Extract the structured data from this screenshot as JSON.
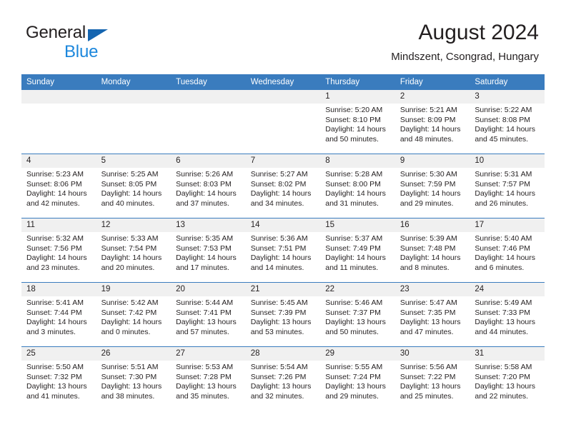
{
  "brand": {
    "word_one": "General",
    "word_two": "Blue",
    "triangle_color": "#1565b0",
    "blue_color": "#1c87dc"
  },
  "header": {
    "month_title": "August 2024",
    "location": "Mindszent, Csongrad, Hungary",
    "accent_color": "#3a7cbe",
    "daynum_bg": "#f0f0f0"
  },
  "calendar": {
    "weekday_headers": [
      "Sunday",
      "Monday",
      "Tuesday",
      "Wednesday",
      "Thursday",
      "Friday",
      "Saturday"
    ],
    "weeks": [
      [
        {
          "day": "",
          "sunrise": "",
          "sunset": "",
          "daylight_line1": "",
          "daylight_line2": "",
          "empty": true
        },
        {
          "day": "",
          "sunrise": "",
          "sunset": "",
          "daylight_line1": "",
          "daylight_line2": "",
          "empty": true
        },
        {
          "day": "",
          "sunrise": "",
          "sunset": "",
          "daylight_line1": "",
          "daylight_line2": "",
          "empty": true
        },
        {
          "day": "",
          "sunrise": "",
          "sunset": "",
          "daylight_line1": "",
          "daylight_line2": "",
          "empty": true
        },
        {
          "day": "1",
          "sunrise": "Sunrise: 5:20 AM",
          "sunset": "Sunset: 8:10 PM",
          "daylight_line1": "Daylight: 14 hours",
          "daylight_line2": "and 50 minutes.",
          "empty": false
        },
        {
          "day": "2",
          "sunrise": "Sunrise: 5:21 AM",
          "sunset": "Sunset: 8:09 PM",
          "daylight_line1": "Daylight: 14 hours",
          "daylight_line2": "and 48 minutes.",
          "empty": false
        },
        {
          "day": "3",
          "sunrise": "Sunrise: 5:22 AM",
          "sunset": "Sunset: 8:08 PM",
          "daylight_line1": "Daylight: 14 hours",
          "daylight_line2": "and 45 minutes.",
          "empty": false
        }
      ],
      [
        {
          "day": "4",
          "sunrise": "Sunrise: 5:23 AM",
          "sunset": "Sunset: 8:06 PM",
          "daylight_line1": "Daylight: 14 hours",
          "daylight_line2": "and 42 minutes.",
          "empty": false
        },
        {
          "day": "5",
          "sunrise": "Sunrise: 5:25 AM",
          "sunset": "Sunset: 8:05 PM",
          "daylight_line1": "Daylight: 14 hours",
          "daylight_line2": "and 40 minutes.",
          "empty": false
        },
        {
          "day": "6",
          "sunrise": "Sunrise: 5:26 AM",
          "sunset": "Sunset: 8:03 PM",
          "daylight_line1": "Daylight: 14 hours",
          "daylight_line2": "and 37 minutes.",
          "empty": false
        },
        {
          "day": "7",
          "sunrise": "Sunrise: 5:27 AM",
          "sunset": "Sunset: 8:02 PM",
          "daylight_line1": "Daylight: 14 hours",
          "daylight_line2": "and 34 minutes.",
          "empty": false
        },
        {
          "day": "8",
          "sunrise": "Sunrise: 5:28 AM",
          "sunset": "Sunset: 8:00 PM",
          "daylight_line1": "Daylight: 14 hours",
          "daylight_line2": "and 31 minutes.",
          "empty": false
        },
        {
          "day": "9",
          "sunrise": "Sunrise: 5:30 AM",
          "sunset": "Sunset: 7:59 PM",
          "daylight_line1": "Daylight: 14 hours",
          "daylight_line2": "and 29 minutes.",
          "empty": false
        },
        {
          "day": "10",
          "sunrise": "Sunrise: 5:31 AM",
          "sunset": "Sunset: 7:57 PM",
          "daylight_line1": "Daylight: 14 hours",
          "daylight_line2": "and 26 minutes.",
          "empty": false
        }
      ],
      [
        {
          "day": "11",
          "sunrise": "Sunrise: 5:32 AM",
          "sunset": "Sunset: 7:56 PM",
          "daylight_line1": "Daylight: 14 hours",
          "daylight_line2": "and 23 minutes.",
          "empty": false
        },
        {
          "day": "12",
          "sunrise": "Sunrise: 5:33 AM",
          "sunset": "Sunset: 7:54 PM",
          "daylight_line1": "Daylight: 14 hours",
          "daylight_line2": "and 20 minutes.",
          "empty": false
        },
        {
          "day": "13",
          "sunrise": "Sunrise: 5:35 AM",
          "sunset": "Sunset: 7:53 PM",
          "daylight_line1": "Daylight: 14 hours",
          "daylight_line2": "and 17 minutes.",
          "empty": false
        },
        {
          "day": "14",
          "sunrise": "Sunrise: 5:36 AM",
          "sunset": "Sunset: 7:51 PM",
          "daylight_line1": "Daylight: 14 hours",
          "daylight_line2": "and 14 minutes.",
          "empty": false
        },
        {
          "day": "15",
          "sunrise": "Sunrise: 5:37 AM",
          "sunset": "Sunset: 7:49 PM",
          "daylight_line1": "Daylight: 14 hours",
          "daylight_line2": "and 11 minutes.",
          "empty": false
        },
        {
          "day": "16",
          "sunrise": "Sunrise: 5:39 AM",
          "sunset": "Sunset: 7:48 PM",
          "daylight_line1": "Daylight: 14 hours",
          "daylight_line2": "and 8 minutes.",
          "empty": false
        },
        {
          "day": "17",
          "sunrise": "Sunrise: 5:40 AM",
          "sunset": "Sunset: 7:46 PM",
          "daylight_line1": "Daylight: 14 hours",
          "daylight_line2": "and 6 minutes.",
          "empty": false
        }
      ],
      [
        {
          "day": "18",
          "sunrise": "Sunrise: 5:41 AM",
          "sunset": "Sunset: 7:44 PM",
          "daylight_line1": "Daylight: 14 hours",
          "daylight_line2": "and 3 minutes.",
          "empty": false
        },
        {
          "day": "19",
          "sunrise": "Sunrise: 5:42 AM",
          "sunset": "Sunset: 7:42 PM",
          "daylight_line1": "Daylight: 14 hours",
          "daylight_line2": "and 0 minutes.",
          "empty": false
        },
        {
          "day": "20",
          "sunrise": "Sunrise: 5:44 AM",
          "sunset": "Sunset: 7:41 PM",
          "daylight_line1": "Daylight: 13 hours",
          "daylight_line2": "and 57 minutes.",
          "empty": false
        },
        {
          "day": "21",
          "sunrise": "Sunrise: 5:45 AM",
          "sunset": "Sunset: 7:39 PM",
          "daylight_line1": "Daylight: 13 hours",
          "daylight_line2": "and 53 minutes.",
          "empty": false
        },
        {
          "day": "22",
          "sunrise": "Sunrise: 5:46 AM",
          "sunset": "Sunset: 7:37 PM",
          "daylight_line1": "Daylight: 13 hours",
          "daylight_line2": "and 50 minutes.",
          "empty": false
        },
        {
          "day": "23",
          "sunrise": "Sunrise: 5:47 AM",
          "sunset": "Sunset: 7:35 PM",
          "daylight_line1": "Daylight: 13 hours",
          "daylight_line2": "and 47 minutes.",
          "empty": false
        },
        {
          "day": "24",
          "sunrise": "Sunrise: 5:49 AM",
          "sunset": "Sunset: 7:33 PM",
          "daylight_line1": "Daylight: 13 hours",
          "daylight_line2": "and 44 minutes.",
          "empty": false
        }
      ],
      [
        {
          "day": "25",
          "sunrise": "Sunrise: 5:50 AM",
          "sunset": "Sunset: 7:32 PM",
          "daylight_line1": "Daylight: 13 hours",
          "daylight_line2": "and 41 minutes.",
          "empty": false
        },
        {
          "day": "26",
          "sunrise": "Sunrise: 5:51 AM",
          "sunset": "Sunset: 7:30 PM",
          "daylight_line1": "Daylight: 13 hours",
          "daylight_line2": "and 38 minutes.",
          "empty": false
        },
        {
          "day": "27",
          "sunrise": "Sunrise: 5:53 AM",
          "sunset": "Sunset: 7:28 PM",
          "daylight_line1": "Daylight: 13 hours",
          "daylight_line2": "and 35 minutes.",
          "empty": false
        },
        {
          "day": "28",
          "sunrise": "Sunrise: 5:54 AM",
          "sunset": "Sunset: 7:26 PM",
          "daylight_line1": "Daylight: 13 hours",
          "daylight_line2": "and 32 minutes.",
          "empty": false
        },
        {
          "day": "29",
          "sunrise": "Sunrise: 5:55 AM",
          "sunset": "Sunset: 7:24 PM",
          "daylight_line1": "Daylight: 13 hours",
          "daylight_line2": "and 29 minutes.",
          "empty": false
        },
        {
          "day": "30",
          "sunrise": "Sunrise: 5:56 AM",
          "sunset": "Sunset: 7:22 PM",
          "daylight_line1": "Daylight: 13 hours",
          "daylight_line2": "and 25 minutes.",
          "empty": false
        },
        {
          "day": "31",
          "sunrise": "Sunrise: 5:58 AM",
          "sunset": "Sunset: 7:20 PM",
          "daylight_line1": "Daylight: 13 hours",
          "daylight_line2": "and 22 minutes.",
          "empty": false
        }
      ]
    ]
  }
}
